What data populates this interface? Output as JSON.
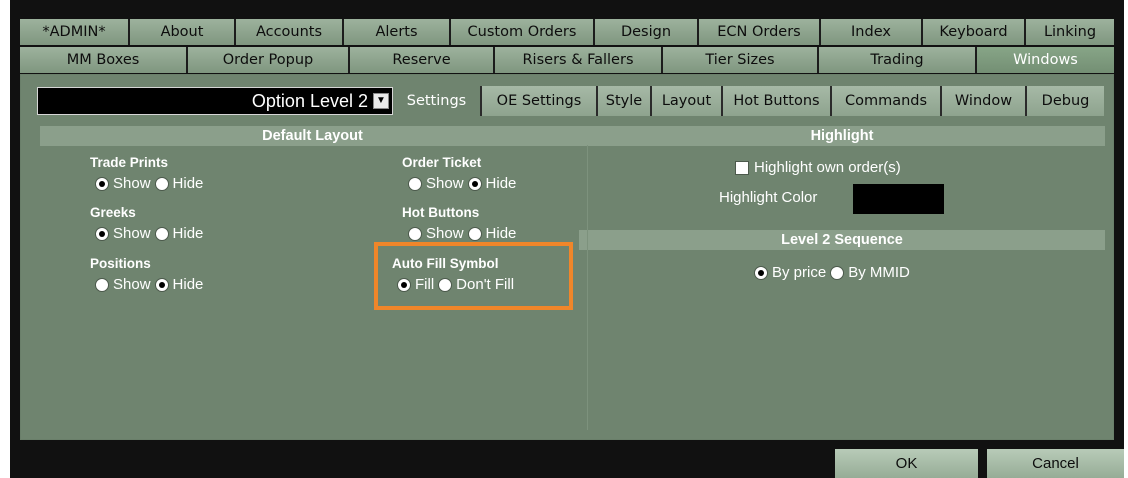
{
  "tabs_row1": [
    {
      "label": "*ADMIN*"
    },
    {
      "label": "About"
    },
    {
      "label": "Accounts"
    },
    {
      "label": "Alerts"
    },
    {
      "label": "Custom Orders"
    },
    {
      "label": "Design"
    },
    {
      "label": "ECN Orders"
    },
    {
      "label": "Index"
    },
    {
      "label": "Keyboard"
    },
    {
      "label": "Linking"
    }
  ],
  "tabs_row2": [
    {
      "label": "MM Boxes"
    },
    {
      "label": "Order Popup"
    },
    {
      "label": "Reserve"
    },
    {
      "label": "Risers & Fallers"
    },
    {
      "label": "Tier Sizes"
    },
    {
      "label": "Trading"
    },
    {
      "label": "Windows"
    }
  ],
  "window_select": {
    "value": "Option Level 2"
  },
  "subtabs": [
    {
      "label": "Settings"
    },
    {
      "label": "OE Settings"
    },
    {
      "label": "Style"
    },
    {
      "label": "Layout"
    },
    {
      "label": "Hot Buttons"
    },
    {
      "label": "Commands"
    },
    {
      "label": "Window"
    },
    {
      "label": "Debug"
    }
  ],
  "default_layout": {
    "header": "Default Layout",
    "trade_prints": {
      "label": "Trade Prints",
      "show": "Show",
      "hide": "Hide",
      "selected": "Show"
    },
    "greeks": {
      "label": "Greeks",
      "show": "Show",
      "hide": "Hide",
      "selected": "Show"
    },
    "positions": {
      "label": "Positions",
      "show": "Show",
      "hide": "Hide",
      "selected": "Hide"
    },
    "order_ticket": {
      "label": "Order Ticket",
      "show": "Show",
      "hide": "Hide",
      "selected": "Hide"
    },
    "hot_buttons": {
      "label": "Hot Buttons",
      "show": "Show",
      "hide": "Hide",
      "selected": "none"
    },
    "auto_fill": {
      "label": "Auto Fill Symbol",
      "fill": "Fill",
      "dont_fill": "Don't Fill",
      "selected": "Fill"
    }
  },
  "highlight": {
    "header": "Highlight",
    "own_orders_label": "Highlight own order(s)",
    "own_orders_checked": false,
    "color_label": "Highlight Color",
    "color_value": "#000000"
  },
  "level2_sequence": {
    "header": "Level 2 Sequence",
    "by_price": "By price",
    "by_mmid": "By MMID",
    "selected": "By price"
  },
  "buttons": {
    "ok": "OK",
    "cancel": "Cancel"
  },
  "colors": {
    "panel": "#6f846f",
    "tab": "#8ea38e",
    "accent_box": "#f0862a"
  }
}
